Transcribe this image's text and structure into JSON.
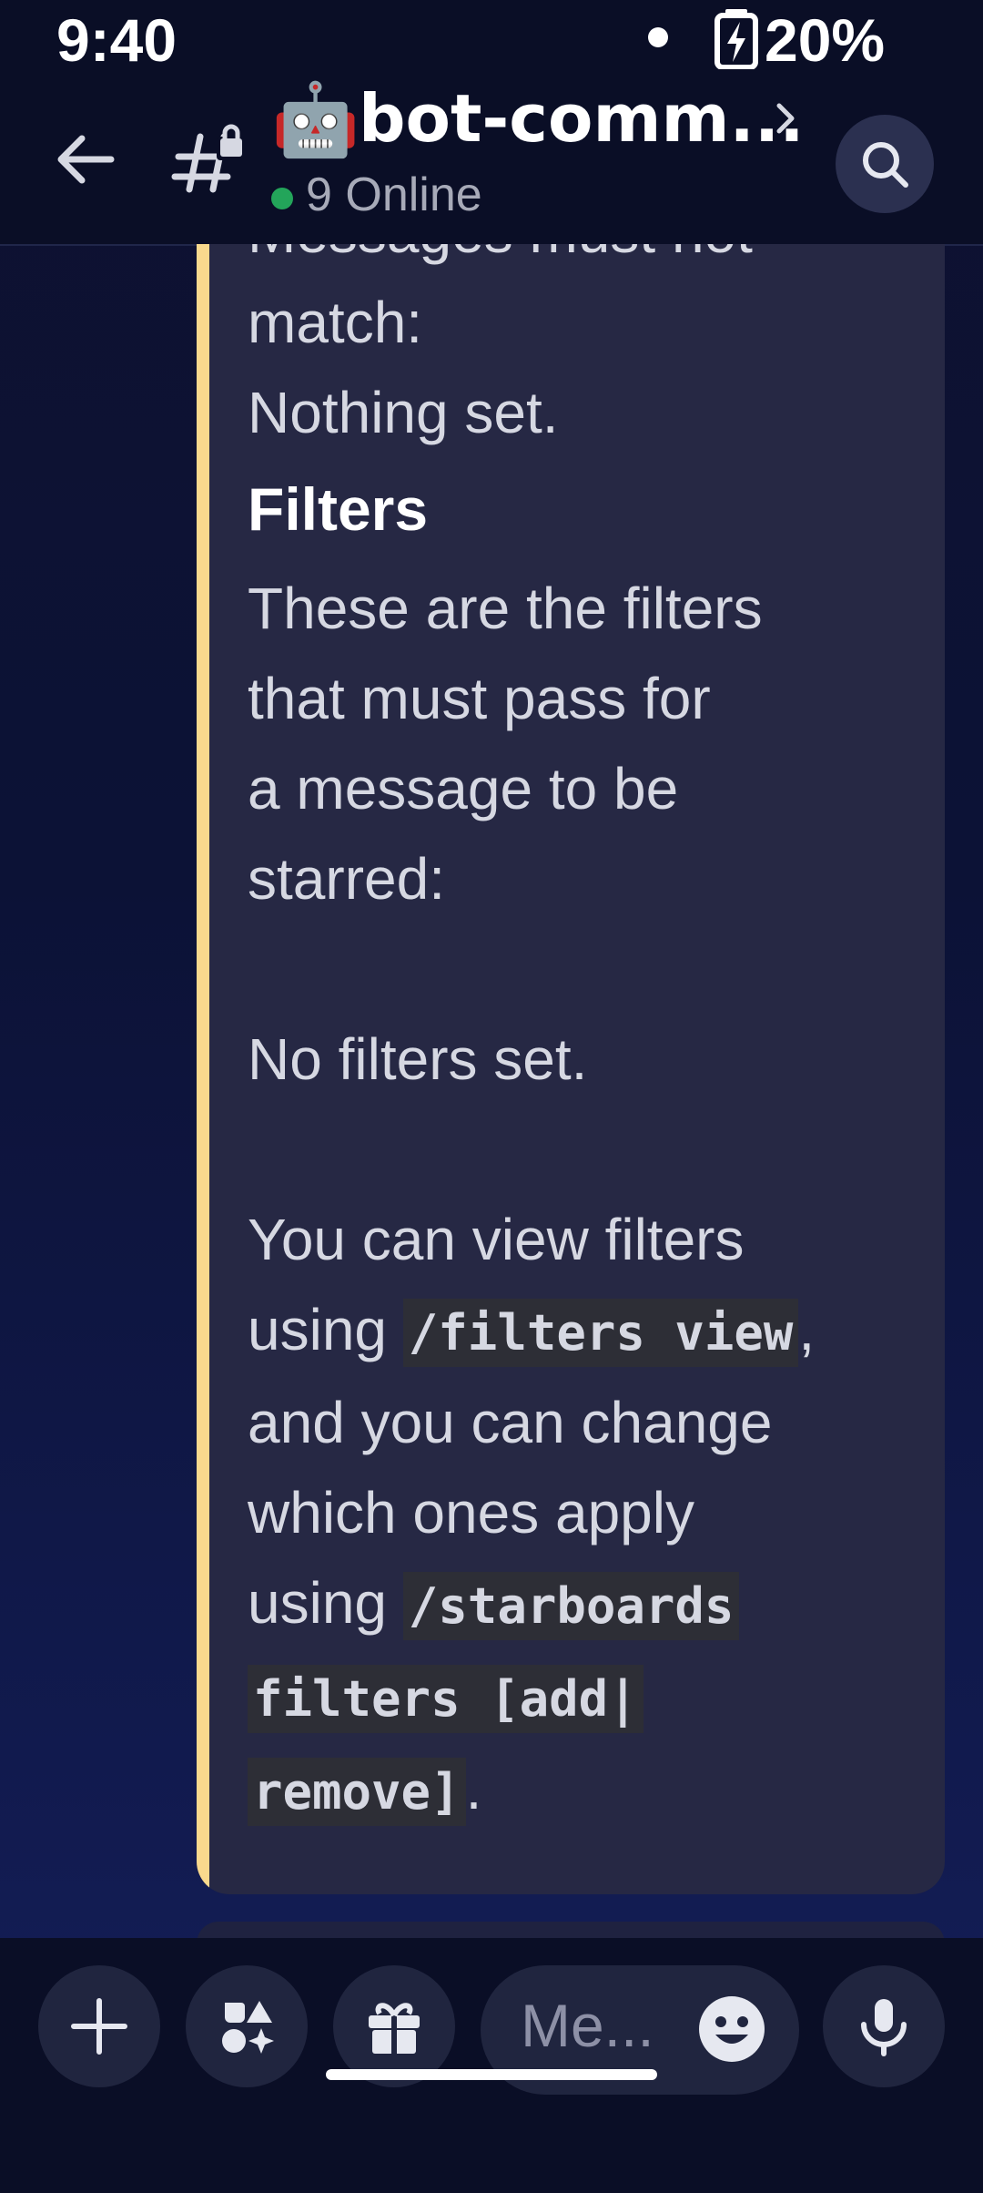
{
  "status_bar": {
    "time": "9:40",
    "battery": "20%"
  },
  "header": {
    "bot_emoji": "🤖",
    "channel_name": "bot-comm...",
    "online_status": "9 Online",
    "icons": [
      "back-arrow-icon",
      "locked-channel-icon",
      "chevron-right-icon",
      "search-icon"
    ],
    "online_color": "#23a55a"
  },
  "embed": {
    "accent_color": "#f9d98d",
    "must_not_match_label": "Messages must not",
    "must_not_match_label_2": "match:",
    "must_not_match_value": "Nothing set.",
    "filters_heading": "Filters",
    "filters_desc_1": "These are the filters",
    "filters_desc_2": "that must pass for",
    "filters_desc_3": "a message to be",
    "filters_desc_4": "starred:",
    "no_filters": "No filters set.",
    "view_text_1": "You can view filters",
    "view_text_2a": "using ",
    "view_code": "/filters view",
    "view_text_2b": ",",
    "change_text_1": "and you can change",
    "change_text_2": "which ones apply",
    "change_text_3a": "using ",
    "change_code_1": "/starboards",
    "change_code_2": "filters [add|",
    "change_code_3": "remove]",
    "change_text_end": "."
  },
  "bottom_bar": {
    "message_placeholder": "Me...",
    "icons": [
      "plus-icon",
      "apps-icon",
      "gift-icon",
      "emoji-icon",
      "microphone-icon"
    ]
  }
}
